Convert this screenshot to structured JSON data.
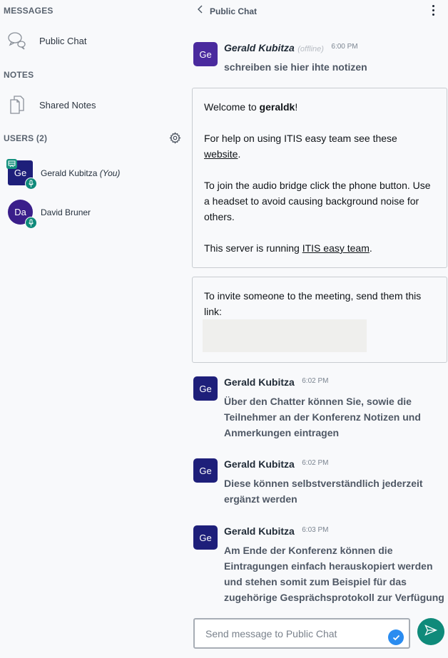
{
  "sidebar": {
    "messages_title": "MESSAGES",
    "public_chat_label": "Public Chat",
    "notes_title": "NOTES",
    "shared_notes_label": "Shared Notes",
    "users_title": "USERS (2)",
    "users": [
      {
        "initials": "Ge",
        "name": "Gerald Kubitza",
        "suffix": "(You)",
        "presenter": true,
        "shape": "square",
        "color": "#1e1f7a"
      },
      {
        "initials": "Da",
        "name": "David Bruner",
        "suffix": "",
        "presenter": false,
        "shape": "round",
        "color": "#3a1e8a"
      }
    ]
  },
  "chat": {
    "title": "Public Chat",
    "messages": [
      {
        "initials": "Ge",
        "name": "Gerald Kubitza",
        "status": "(offline)",
        "time": "6:00 PM",
        "text": "schreiben sie hier ihte notizen",
        "avatar_color": "#4a2a9e"
      },
      {
        "initials": "Ge",
        "name": "Gerald Kubitza",
        "status": "",
        "time": "6:02 PM",
        "text": "Über den Chatter können Sie, sowie die Teilnehmer an der Konferenz Notizen und Anmerkungen eintragen",
        "avatar_color": "#1e1f7a"
      },
      {
        "initials": "Ge",
        "name": "Gerald Kubitza",
        "status": "",
        "time": "6:02 PM",
        "text": "Diese können selbstverständlich jederzeit ergänzt werden",
        "avatar_color": "#1e1f7a"
      },
      {
        "initials": "Ge",
        "name": "Gerald Kubitza",
        "status": "",
        "time": "6:03 PM",
        "text": "Am Ende der Konferenz können die Eintragungen einfach herauskopiert werden und stehen somit zum Beispiel für das zugehörige Gesprächsprotokoll zur Verfügung",
        "avatar_color": "#1e1f7a"
      }
    ],
    "welcome": {
      "line1_prefix": "Welcome to ",
      "line1_bold": "geraldk",
      "line1_suffix": "!",
      "line2_prefix": "For help on using ITIS easy team see these ",
      "line2_link": "website",
      "line2_suffix": ".",
      "line3": "To join the audio bridge click the phone button. Use a headset to avoid causing background noise for others.",
      "line4_prefix": "This server is running ",
      "line4_link": "ITIS easy team",
      "line4_suffix": "."
    },
    "invite": {
      "text": "To invite someone to the meeting, send them this link:"
    },
    "composer": {
      "placeholder": "Send message to Public Chat"
    }
  },
  "colors": {
    "accent": "#0f8a7a",
    "check": "#2a8cf0"
  }
}
